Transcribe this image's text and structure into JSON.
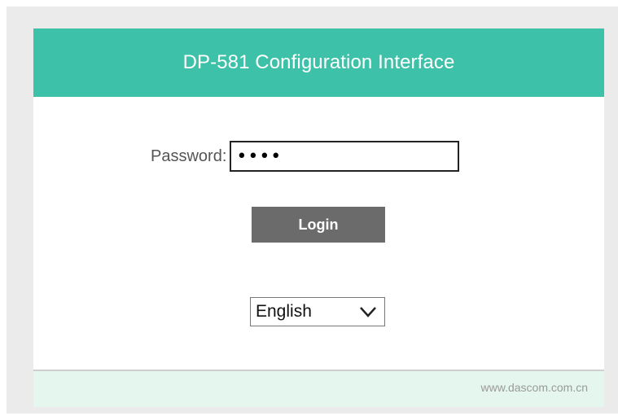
{
  "header": {
    "title": "DP-581 Configuration Interface"
  },
  "form": {
    "password_label": "Password:",
    "password_value": "1234",
    "login_label": "Login"
  },
  "language": {
    "selected": "English",
    "icon": "chevron-down-icon"
  },
  "footer": {
    "link_text": "www.dascom.com.cn"
  },
  "colors": {
    "header_bg": "#3dc1a8",
    "button_bg": "#6b6b6b",
    "footer_bg": "#e5f6ee",
    "page_bg": "#ebebeb"
  }
}
